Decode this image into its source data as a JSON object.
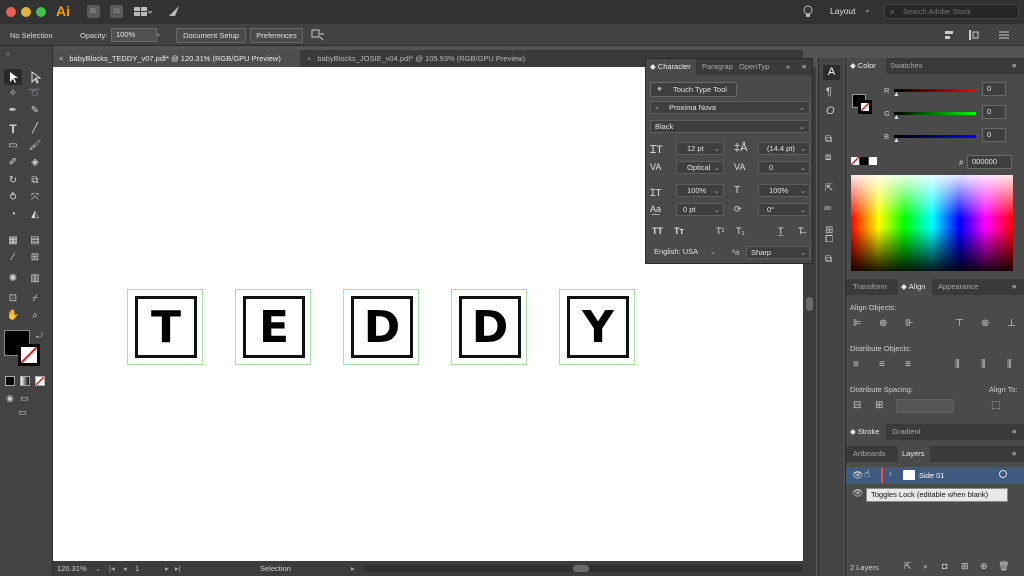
{
  "app": {
    "logo": "Ai"
  },
  "topbar": {
    "workspace": "Layout",
    "search_placeholder": "Search Adobe Stock"
  },
  "control": {
    "selection": "No Selection",
    "opacity_label": "Opacity:",
    "opacity_value": "100%",
    "document_setup": "Document Setup",
    "preferences": "Preferences"
  },
  "doc_tabs": [
    {
      "label": "babyBlocks_TEDDY_v07.pdf* @ 120.31% (RGB/GPU Preview)",
      "active": true
    },
    {
      "label": "babyBlocks_JOSIE_v04.pdf* @ 105.93% (RGB/GPU Preview)",
      "active": false
    }
  ],
  "canvas": {
    "letters": [
      "T",
      "E",
      "D",
      "D",
      "Y"
    ]
  },
  "status": {
    "zoom": "120.31%",
    "artboard": "1",
    "tool": "Selection"
  },
  "character": {
    "tabs": [
      "Character",
      "Paragrap",
      "OpenTyp"
    ],
    "touch_type": "Touch Type Tool",
    "font_family": "Proxima Nova",
    "font_style": "Black",
    "font_size": "12 pt",
    "leading": "(14.4 pt)",
    "kerning": "Optical",
    "tracking": "0",
    "vertical_scale": "100%",
    "horizontal_scale": "100%",
    "baseline_shift": "0 pt",
    "rotation": "0°",
    "language": "English: USA",
    "anti_alias_prefix": "ªa",
    "anti_alias": "Sharp"
  },
  "color": {
    "tabs": [
      "Color",
      "Swatches"
    ],
    "r_label": "R",
    "g_label": "G",
    "b_label": "B",
    "r": "0",
    "g": "0",
    "b": "0",
    "hex_label": "#",
    "hex": "000000"
  },
  "transform_tabs": [
    "Transform",
    "Align",
    "Appearance"
  ],
  "align": {
    "align_objects": "Align Objects:",
    "distribute_objects": "Distribute Objects:",
    "distribute_spacing": "Distribute Spacing:",
    "align_to": "Align To:"
  },
  "stroke_tabs": [
    "Stroke",
    "Gradient"
  ],
  "layers": {
    "tabs": [
      "Artboards",
      "Layers"
    ],
    "layer_name": "Side 01",
    "count": "2 Layers",
    "tooltip": "Toggles Lock (editable when blank)"
  }
}
